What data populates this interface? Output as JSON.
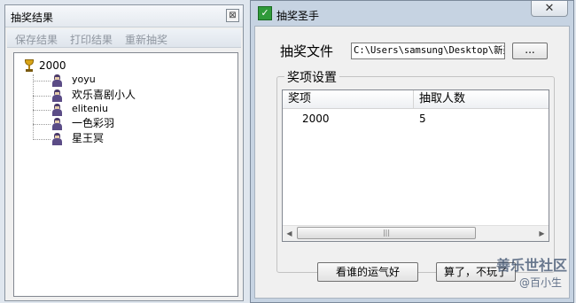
{
  "left_window": {
    "title": "抽奖结果",
    "close_glyph": "⊠",
    "menu": [
      "保存结果",
      "打印结果",
      "重新抽奖"
    ],
    "tree": {
      "root": "2000",
      "children": [
        "yoyu",
        "欢乐喜剧小人",
        "eliteniu",
        "一色彩羽",
        "星王冥"
      ]
    }
  },
  "right_window": {
    "title": "抽奖圣手",
    "icon_glyph": "✓",
    "close_glyph": "✕",
    "file_label": "抽奖文件",
    "file_path": "C:\\Users\\samsung\\Desktop\\新建",
    "browse_label": "...",
    "group_title": "奖项设置",
    "columns": [
      "奖项",
      "抽取人数"
    ],
    "rows": [
      {
        "prize": "2000",
        "count": "5"
      }
    ],
    "scroll_grip": "|||",
    "luck_button": "看谁的运气好",
    "quit_button": "算了，不玩了"
  },
  "watermark": {
    "line1": "善乐世社区",
    "line2": "@百小生"
  },
  "icons": {
    "root": "trophy-icon",
    "child": "user-icon"
  }
}
